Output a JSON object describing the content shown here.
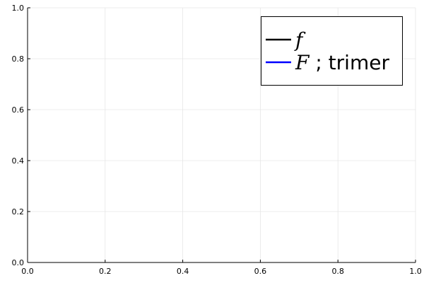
{
  "chart_data": {
    "type": "line",
    "xlim": [
      0,
      1
    ],
    "ylim": [
      0,
      1
    ],
    "grid": true,
    "x_ticks": [
      {
        "value": 0,
        "label": "0.0"
      },
      {
        "value": 0.2,
        "label": "0.2"
      },
      {
        "value": 0.4,
        "label": "0.4"
      },
      {
        "value": 0.6,
        "label": "0.6"
      },
      {
        "value": 0.8,
        "label": "0.8"
      },
      {
        "value": 1,
        "label": "1.0"
      }
    ],
    "y_ticks": [
      {
        "value": 0,
        "label": "0.0"
      },
      {
        "value": 0.2,
        "label": "0.2"
      },
      {
        "value": 0.4,
        "label": "0.4"
      },
      {
        "value": 0.6,
        "label": "0.6"
      },
      {
        "value": 0.8,
        "label": "0.8"
      },
      {
        "value": 1,
        "label": "1.0"
      }
    ],
    "series": [
      {
        "name": "f",
        "name_suffix": "",
        "color": "#000000",
        "x": [],
        "y": []
      },
      {
        "name": "F",
        "name_suffix": " ; trimer",
        "color": "#0000ff",
        "x": [],
        "y": []
      }
    ],
    "legend_position": "top-right"
  }
}
